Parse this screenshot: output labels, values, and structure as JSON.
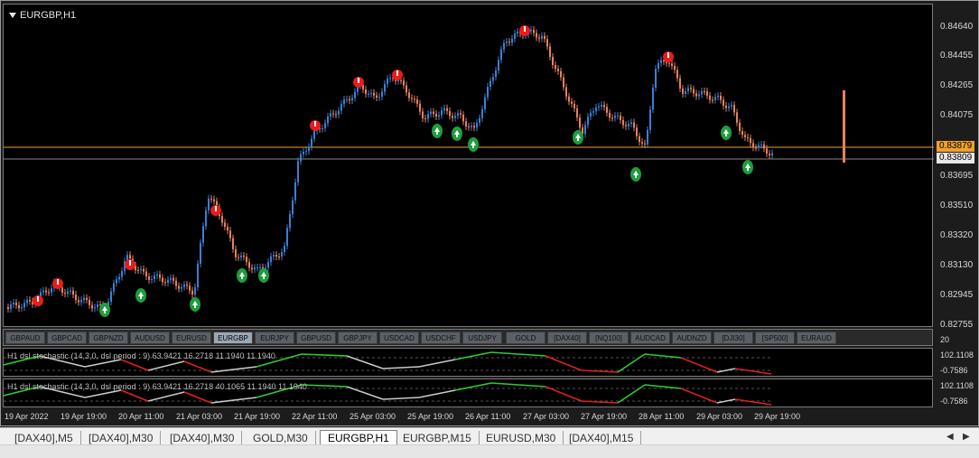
{
  "window": {
    "title": "EURGBP,H1"
  },
  "colors": {
    "bull": "#3c7fd6",
    "bear": "#e8825c",
    "bid_line": "#f0a030",
    "ask_line": "#8a8a8a",
    "stoch_up": "#2ecc2e",
    "stoch_down": "#e02020",
    "stoch_mid": "#c8c8c8"
  },
  "price_axis": {
    "labels": [
      "0.84640",
      "0.84455",
      "0.84265",
      "0.84075",
      "0.83879",
      "0.83809",
      "0.83695",
      "0.83510",
      "0.83320",
      "0.83130",
      "0.82945",
      "0.82755"
    ],
    "bid_price": "0.83879",
    "ask_price": "0.83809"
  },
  "symbols": {
    "items": [
      "GBPAUD",
      "GBPCAD",
      "GBPNZD",
      "AUDUSD",
      "EURUSD",
      "EURGBP",
      "EURJPY",
      "GBPUSD",
      "GBPJPY",
      "USDCAD",
      "USDCHF",
      "USDJPY",
      "GOLD",
      "[DAX40]",
      "[NQ100]",
      "AUDCAD",
      "AUDNZD",
      "[DJI30]",
      "[SP500]",
      "EURAUD"
    ],
    "active": "EURGBP"
  },
  "indicators": [
    {
      "label": "H1 dsl stochastic (14,3,0, dsl period : 9) 63.9421 16.2718 11.1940 11.1940",
      "top": "20",
      "high": "102.1108",
      "low": "-0.7586"
    },
    {
      "label": "H1 dsl stochastic (14,3,0, dsl period : 9) 63.9421 16.2718 40.1065 11.1940 11.1940",
      "top": "",
      "high": "102.1108",
      "low": "-0.7586"
    }
  ],
  "time_axis": [
    "19 Apr 2022",
    "19 Apr 19:00",
    "20 Apr 11:00",
    "21 Apr 03:00",
    "21 Apr 19:00",
    "22 Apr 11:00",
    "25 Apr 03:00",
    "25 Apr 19:00",
    "26 Apr 11:00",
    "27 Apr 03:00",
    "27 Apr 19:00",
    "28 Apr 11:00",
    "29 Apr 03:00",
    "29 Apr 19:00"
  ],
  "tabs": {
    "items": [
      "[DAX40],M5",
      "[DAX40],M30",
      "[DAX40],M30",
      "GOLD,M30",
      "EURGBP,H1",
      "EURGBP,M15",
      "EURUSD,M30",
      "[DAX40],M15"
    ],
    "active": "EURGBP,H1"
  }
}
